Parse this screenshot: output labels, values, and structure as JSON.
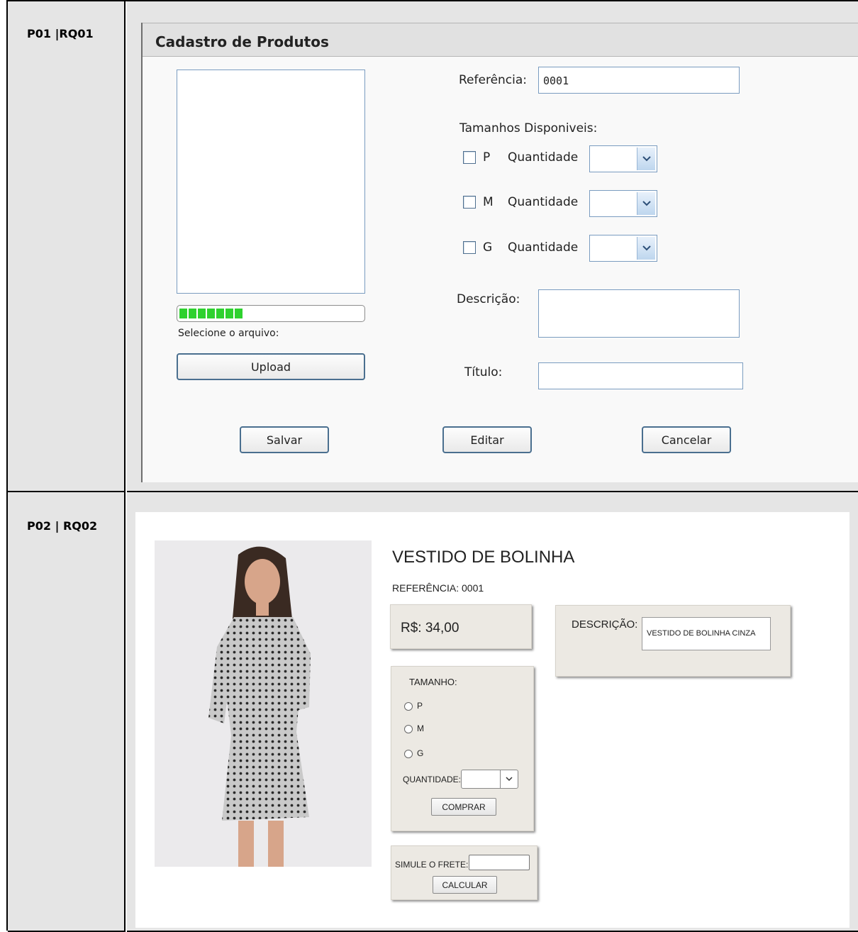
{
  "rows": [
    {
      "label": "P01 |RQ01"
    },
    {
      "label": "P02 | RQ02"
    }
  ],
  "form": {
    "title": "Cadastro de Produtos",
    "upload_progress": 0.35,
    "file_label": "Selecione o arquivo:",
    "upload_button": "Upload",
    "reference_label": "Referência:",
    "reference_value": "0001",
    "sizes_label": "Tamanhos Disponiveis:",
    "sizes": [
      {
        "size": "P",
        "qty_label": "Quantidade",
        "checked": false
      },
      {
        "size": "M",
        "qty_label": "Quantidade",
        "checked": false
      },
      {
        "size": "G",
        "qty_label": "Quantidade",
        "checked": false
      }
    ],
    "description_label": "Descrição:",
    "description_value": "",
    "title_label": "Título:",
    "title_value": "",
    "save_button": "Salvar",
    "edit_button": "Editar",
    "cancel_button": "Cancelar",
    "select_arrow_icon": "chevron-down-icon"
  },
  "product": {
    "name": "VESTIDO DE BOLINHA",
    "reference": "REFERÊNCIA: 0001",
    "price": "R$: 34,00",
    "description_label": "DESCRIÇÃO:",
    "description_value": "VESTIDO DE BOLINHA CINZA",
    "size_label": "TAMANHO:",
    "size_options": [
      "P",
      "M",
      "G"
    ],
    "quantity_label": "QUANTIDADE:",
    "buy_button": "COMPRAR",
    "shipping_label": "SIMULE O FRETE:",
    "shipping_value": "",
    "calc_button": "CALCULAR",
    "photo_icon": "model-photo"
  }
}
